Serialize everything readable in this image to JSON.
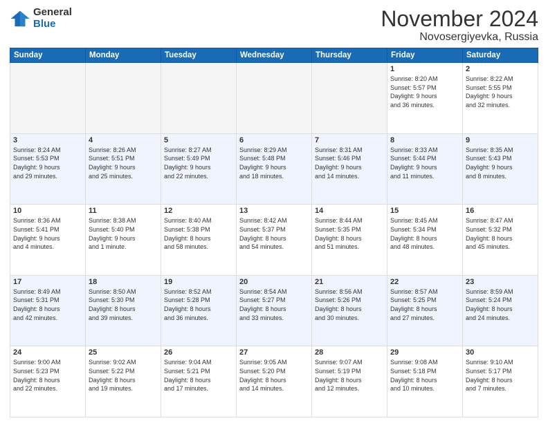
{
  "header": {
    "logo_general": "General",
    "logo_blue": "Blue",
    "month_title": "November 2024",
    "location": "Novosergiyevka, Russia"
  },
  "days_of_week": [
    "Sunday",
    "Monday",
    "Tuesday",
    "Wednesday",
    "Thursday",
    "Friday",
    "Saturday"
  ],
  "weeks": [
    [
      {
        "day": "",
        "info": ""
      },
      {
        "day": "",
        "info": ""
      },
      {
        "day": "",
        "info": ""
      },
      {
        "day": "",
        "info": ""
      },
      {
        "day": "",
        "info": ""
      },
      {
        "day": "1",
        "info": "Sunrise: 8:20 AM\nSunset: 5:57 PM\nDaylight: 9 hours\nand 36 minutes."
      },
      {
        "day": "2",
        "info": "Sunrise: 8:22 AM\nSunset: 5:55 PM\nDaylight: 9 hours\nand 32 minutes."
      }
    ],
    [
      {
        "day": "3",
        "info": "Sunrise: 8:24 AM\nSunset: 5:53 PM\nDaylight: 9 hours\nand 29 minutes."
      },
      {
        "day": "4",
        "info": "Sunrise: 8:26 AM\nSunset: 5:51 PM\nDaylight: 9 hours\nand 25 minutes."
      },
      {
        "day": "5",
        "info": "Sunrise: 8:27 AM\nSunset: 5:49 PM\nDaylight: 9 hours\nand 22 minutes."
      },
      {
        "day": "6",
        "info": "Sunrise: 8:29 AM\nSunset: 5:48 PM\nDaylight: 9 hours\nand 18 minutes."
      },
      {
        "day": "7",
        "info": "Sunrise: 8:31 AM\nSunset: 5:46 PM\nDaylight: 9 hours\nand 14 minutes."
      },
      {
        "day": "8",
        "info": "Sunrise: 8:33 AM\nSunset: 5:44 PM\nDaylight: 9 hours\nand 11 minutes."
      },
      {
        "day": "9",
        "info": "Sunrise: 8:35 AM\nSunset: 5:43 PM\nDaylight: 9 hours\nand 8 minutes."
      }
    ],
    [
      {
        "day": "10",
        "info": "Sunrise: 8:36 AM\nSunset: 5:41 PM\nDaylight: 9 hours\nand 4 minutes."
      },
      {
        "day": "11",
        "info": "Sunrise: 8:38 AM\nSunset: 5:40 PM\nDaylight: 9 hours\nand 1 minute."
      },
      {
        "day": "12",
        "info": "Sunrise: 8:40 AM\nSunset: 5:38 PM\nDaylight: 8 hours\nand 58 minutes."
      },
      {
        "day": "13",
        "info": "Sunrise: 8:42 AM\nSunset: 5:37 PM\nDaylight: 8 hours\nand 54 minutes."
      },
      {
        "day": "14",
        "info": "Sunrise: 8:44 AM\nSunset: 5:35 PM\nDaylight: 8 hours\nand 51 minutes."
      },
      {
        "day": "15",
        "info": "Sunrise: 8:45 AM\nSunset: 5:34 PM\nDaylight: 8 hours\nand 48 minutes."
      },
      {
        "day": "16",
        "info": "Sunrise: 8:47 AM\nSunset: 5:32 PM\nDaylight: 8 hours\nand 45 minutes."
      }
    ],
    [
      {
        "day": "17",
        "info": "Sunrise: 8:49 AM\nSunset: 5:31 PM\nDaylight: 8 hours\nand 42 minutes."
      },
      {
        "day": "18",
        "info": "Sunrise: 8:50 AM\nSunset: 5:30 PM\nDaylight: 8 hours\nand 39 minutes."
      },
      {
        "day": "19",
        "info": "Sunrise: 8:52 AM\nSunset: 5:28 PM\nDaylight: 8 hours\nand 36 minutes."
      },
      {
        "day": "20",
        "info": "Sunrise: 8:54 AM\nSunset: 5:27 PM\nDaylight: 8 hours\nand 33 minutes."
      },
      {
        "day": "21",
        "info": "Sunrise: 8:56 AM\nSunset: 5:26 PM\nDaylight: 8 hours\nand 30 minutes."
      },
      {
        "day": "22",
        "info": "Sunrise: 8:57 AM\nSunset: 5:25 PM\nDaylight: 8 hours\nand 27 minutes."
      },
      {
        "day": "23",
        "info": "Sunrise: 8:59 AM\nSunset: 5:24 PM\nDaylight: 8 hours\nand 24 minutes."
      }
    ],
    [
      {
        "day": "24",
        "info": "Sunrise: 9:00 AM\nSunset: 5:23 PM\nDaylight: 8 hours\nand 22 minutes."
      },
      {
        "day": "25",
        "info": "Sunrise: 9:02 AM\nSunset: 5:22 PM\nDaylight: 8 hours\nand 19 minutes."
      },
      {
        "day": "26",
        "info": "Sunrise: 9:04 AM\nSunset: 5:21 PM\nDaylight: 8 hours\nand 17 minutes."
      },
      {
        "day": "27",
        "info": "Sunrise: 9:05 AM\nSunset: 5:20 PM\nDaylight: 8 hours\nand 14 minutes."
      },
      {
        "day": "28",
        "info": "Sunrise: 9:07 AM\nSunset: 5:19 PM\nDaylight: 8 hours\nand 12 minutes."
      },
      {
        "day": "29",
        "info": "Sunrise: 9:08 AM\nSunset: 5:18 PM\nDaylight: 8 hours\nand 10 minutes."
      },
      {
        "day": "30",
        "info": "Sunrise: 9:10 AM\nSunset: 5:17 PM\nDaylight: 8 hours\nand 7 minutes."
      }
    ]
  ]
}
